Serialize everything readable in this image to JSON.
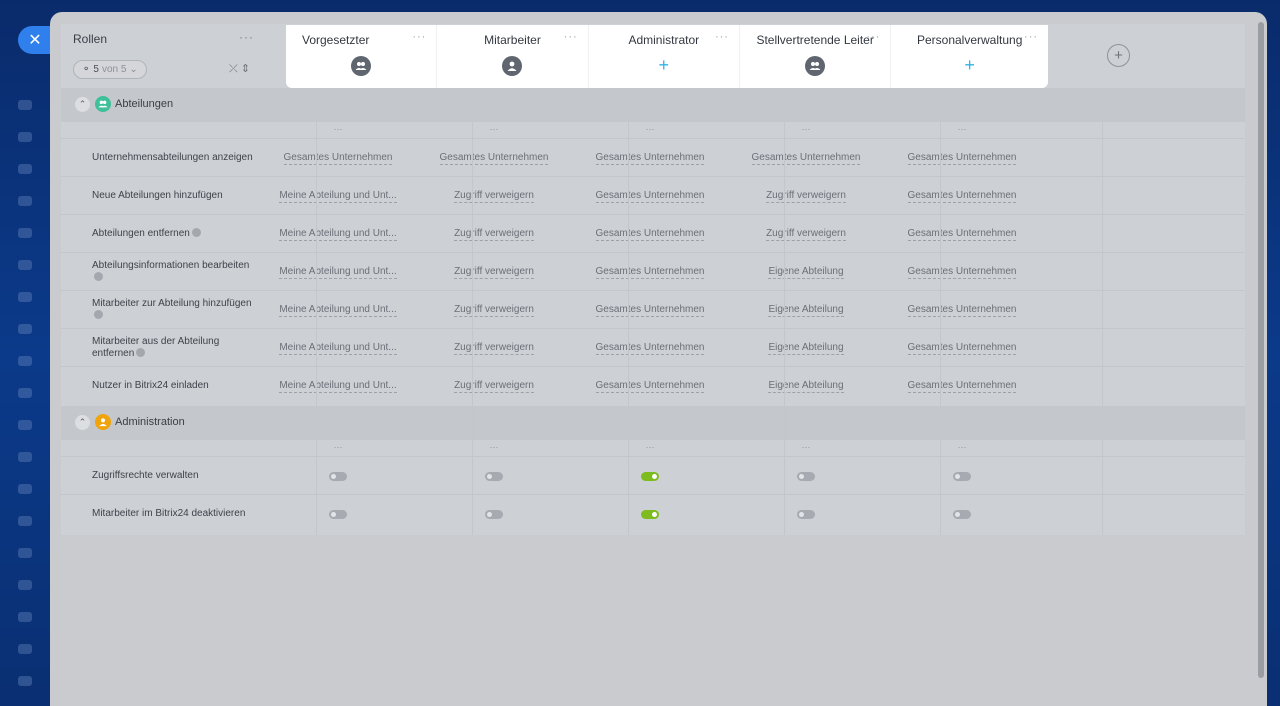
{
  "header": {
    "roles_title": "Rollen",
    "filter_count": "5",
    "filter_total": "von 5",
    "more": "···",
    "sort_icon": "sort-icon"
  },
  "roles": [
    {
      "name": "Vorgesetzter",
      "icon": "group-icon"
    },
    {
      "name": "Mitarbeiter",
      "icon": "user-icon"
    },
    {
      "name": "Administrator",
      "icon": "add-icon"
    },
    {
      "name": "Stellvertretende Leiter",
      "icon": "group-icon"
    },
    {
      "name": "Personalverwaltung",
      "icon": "add-icon"
    }
  ],
  "add_role": "+",
  "sections": [
    {
      "title": "Abteilungen",
      "icon_color": "#3fbf9a",
      "rows": [
        {
          "label": "Unternehmensabteilungen anzeigen",
          "help": false,
          "values": [
            "Gesamtes Unternehmen",
            "Gesamtes Unternehmen",
            "Gesamtes Unternehmen",
            "Gesamtes Unternehmen",
            "Gesamtes Unternehmen"
          ]
        },
        {
          "label": "Neue Abteilungen hinzufügen",
          "help": false,
          "values": [
            "Meine Abteilung und Unt...",
            "Zugriff verweigern",
            "Gesamtes Unternehmen",
            "Zugriff verweigern",
            "Gesamtes Unternehmen"
          ]
        },
        {
          "label": "Abteilungen entfernen",
          "help": true,
          "values": [
            "Meine Abteilung und Unt...",
            "Zugriff verweigern",
            "Gesamtes Unternehmen",
            "Zugriff verweigern",
            "Gesamtes Unternehmen"
          ]
        },
        {
          "label": "Abteilungsinformationen bearbeiten",
          "help": true,
          "values": [
            "Meine Abteilung und Unt...",
            "Zugriff verweigern",
            "Gesamtes Unternehmen",
            "Eigene Abteilung",
            "Gesamtes Unternehmen"
          ]
        },
        {
          "label": "Mitarbeiter zur Abteilung hinzufügen",
          "help": true,
          "values": [
            "Meine Abteilung und Unt...",
            "Zugriff verweigern",
            "Gesamtes Unternehmen",
            "Eigene Abteilung",
            "Gesamtes Unternehmen"
          ]
        },
        {
          "label": "Mitarbeiter aus der Abteilung entfernen",
          "help": true,
          "values": [
            "Meine Abteilung und Unt...",
            "Zugriff verweigern",
            "Gesamtes Unternehmen",
            "Eigene Abteilung",
            "Gesamtes Unternehmen"
          ]
        },
        {
          "label": "Nutzer in Bitrix24 einladen",
          "help": false,
          "values": [
            "Meine Abteilung und Unt...",
            "Zugriff verweigern",
            "Gesamtes Unternehmen",
            "Eigene Abteilung",
            "Gesamtes Unternehmen"
          ]
        }
      ]
    },
    {
      "title": "Administration",
      "icon_color": "#f0a30a",
      "rows": [
        {
          "label": "Zugriffsrechte verwalten",
          "toggles": [
            false,
            false,
            true,
            false,
            false
          ]
        },
        {
          "label": "Mitarbeiter im Bitrix24 deaktivieren",
          "toggles": [
            false,
            false,
            true,
            false,
            false
          ]
        }
      ]
    }
  ],
  "colors": {
    "accent": "#2f80ed",
    "toggle_on": "#7dbb1e",
    "add": "#2fb3e6"
  }
}
